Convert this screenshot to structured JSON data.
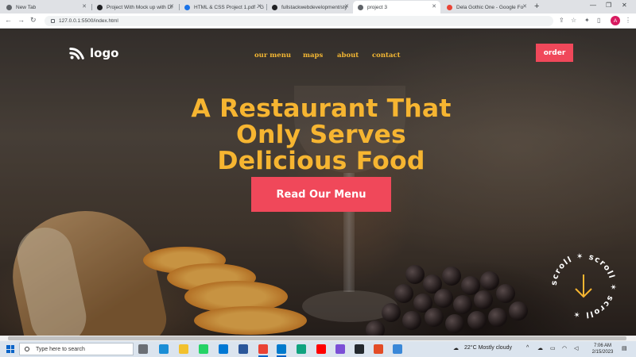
{
  "browser": {
    "tabs": [
      {
        "title": "New Tab",
        "color": "#5f6368"
      },
      {
        "title": "Project With Mock up with Di",
        "color": "#202124"
      },
      {
        "title": "HTML & CSS Project 1.pdf - G",
        "color": "#1a73e8"
      },
      {
        "title": "fullstackwebdevelopment/sty",
        "color": "#202124"
      },
      {
        "title": "project 3",
        "color": "#5f6368"
      },
      {
        "title": "Dela Gothic One - Google Fo",
        "color": "#ea4335"
      }
    ],
    "active_tab": 4,
    "url": "127.0.0.1:5500/index.html",
    "profile_initial": "A"
  },
  "page": {
    "logo_text": "logo",
    "nav": [
      "our menu",
      "maps",
      "about",
      "contact"
    ],
    "order_label": "order",
    "hero_lines": [
      "A Restaurant That",
      "Only Serves",
      "Delicious Food"
    ],
    "cta_label": "Read Our Menu",
    "scroll_text": "scroll ✶ scroll ✶ scroll ✶ ",
    "colors": {
      "accent": "#f0485a",
      "headline": "#f6b531",
      "nav": "#f4b733"
    }
  },
  "taskbar": {
    "search_placeholder": "Type here to search",
    "weather": "22°C  Mostly cloudy",
    "time": "7:06 AM",
    "date": "2/15/2023"
  }
}
